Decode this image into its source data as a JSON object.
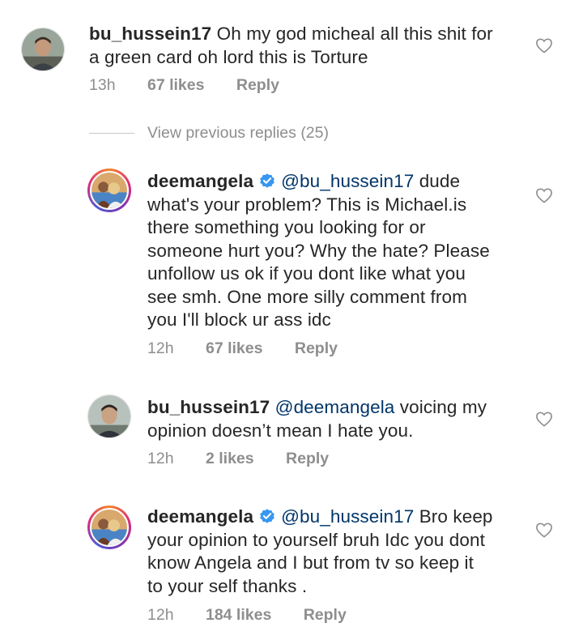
{
  "comments": [
    {
      "username": "bu_hussein17",
      "verified": false,
      "mention": "",
      "lines": [
        "Oh my god micheal all this shit for",
        "a green card oh lord this is Torture"
      ],
      "time": "13h",
      "likes": "67 likes",
      "reply": "Reply",
      "avatar_icon": "profile-photo"
    },
    {
      "username": "deemangela",
      "verified": true,
      "mention": "@bu_hussein17",
      "lines": [
        "dude",
        "what's your problem? This is Michael.is",
        "there something you looking for or",
        "someone hurt you? Why the hate? Please",
        "unfollow us ok if you dont like what you",
        "see smh. One more silly comment from",
        "you I'll block ur ass idc"
      ],
      "time": "12h",
      "likes": "67 likes",
      "reply": "Reply",
      "avatar_icon": "profile-photo-story-ring"
    },
    {
      "username": "bu_hussein17",
      "verified": false,
      "mention": "@deemangela",
      "lines": [
        " voicing my",
        "opinion doesn’t mean I hate you."
      ],
      "time": "12h",
      "likes": "2 likes",
      "reply": "Reply",
      "avatar_icon": "profile-photo"
    },
    {
      "username": "deemangela",
      "verified": true,
      "mention": "@bu_hussein17",
      "lines": [
        "Bro keep",
        "your opinion to yourself bruh Idc you dont",
        "know Angela and I but from tv so keep it",
        "to your self thanks ."
      ],
      "time": "12h",
      "likes": "184 likes",
      "reply": "Reply",
      "avatar_icon": "profile-photo-story-ring"
    }
  ],
  "view_previous": "View previous replies (25)",
  "colors": {
    "text": "#262626",
    "muted": "#8e8e8e",
    "mention": "#003569",
    "verified": "#3897f0"
  },
  "icons": [
    "heart-icon",
    "verified-badge-icon"
  ]
}
